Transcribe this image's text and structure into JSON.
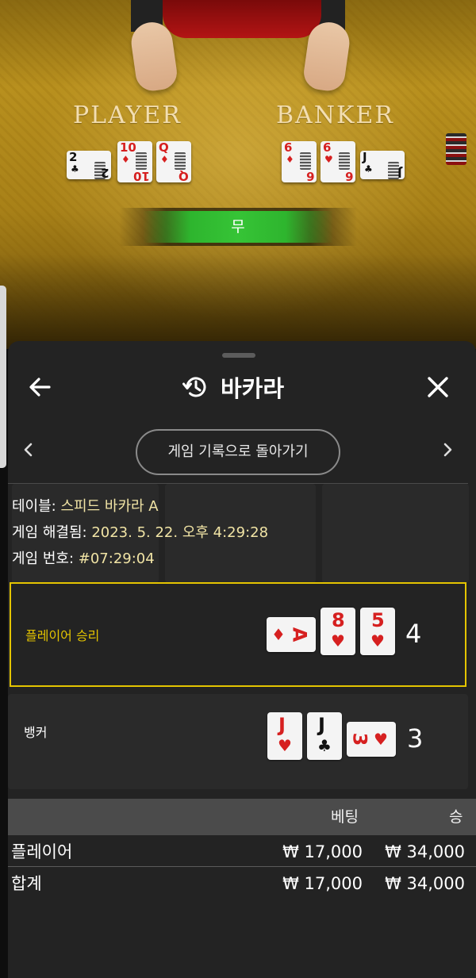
{
  "live_table": {
    "player_label": "PLAYER",
    "banker_label": "BANKER",
    "player_cards": [
      {
        "rank": "2",
        "suit": "♣",
        "color": "black"
      },
      {
        "rank": "10",
        "suit": "♦",
        "color": "red"
      },
      {
        "rank": "Q",
        "suit": "♦",
        "color": "red"
      }
    ],
    "banker_cards": [
      {
        "rank": "6",
        "suit": "♦",
        "color": "red"
      },
      {
        "rank": "6",
        "suit": "♥",
        "color": "red"
      },
      {
        "rank": "J",
        "suit": "♣",
        "color": "black"
      }
    ],
    "result_banner": "무",
    "colors": {
      "felt": "#b8901e",
      "banner": "#36c436"
    }
  },
  "header": {
    "back_icon": "arrow-left-icon",
    "history_icon": "history-clock-icon",
    "title": "바카라",
    "close_icon": "close-icon"
  },
  "nav": {
    "back_pill": "게임 기록으로 돌아가기",
    "prev_icon": "chevron-left-icon",
    "next_icon": "chevron-right-icon"
  },
  "info": {
    "table_key": "테이블:",
    "table_value": "스피드 바카라 A",
    "resolved_key": "게임 해결됨:",
    "resolved_value": "2023. 5. 22. 오후 4:29:28",
    "number_key": "게임 번호:",
    "number_value": "#07:29:04"
  },
  "results": {
    "player": {
      "label": "플레이어 승리",
      "label_color": "#e4c400",
      "score": "4",
      "cards": [
        {
          "rank": "A",
          "suit": "♦",
          "color": "red",
          "orientation": "sideways"
        },
        {
          "rank": "8",
          "suit": "♥",
          "color": "red",
          "orientation": "upright"
        },
        {
          "rank": "5",
          "suit": "♥",
          "color": "red",
          "orientation": "upright"
        }
      ]
    },
    "banker": {
      "label": "뱅커",
      "score": "3",
      "cards": [
        {
          "rank": "J",
          "suit": "♥",
          "color": "red",
          "orientation": "upright"
        },
        {
          "rank": "J",
          "suit": "♣",
          "color": "black",
          "orientation": "upright"
        },
        {
          "rank": "3",
          "suit": "♥",
          "color": "red",
          "orientation": "sideways"
        }
      ]
    }
  },
  "bets_table": {
    "columns": [
      "베팅",
      "승"
    ],
    "rows": [
      {
        "label": "플레이어",
        "bet": "₩ 17,000",
        "win": "₩ 34,000"
      }
    ],
    "total": {
      "label": "합계",
      "bet": "₩ 17,000",
      "win": "₩ 34,000"
    }
  }
}
